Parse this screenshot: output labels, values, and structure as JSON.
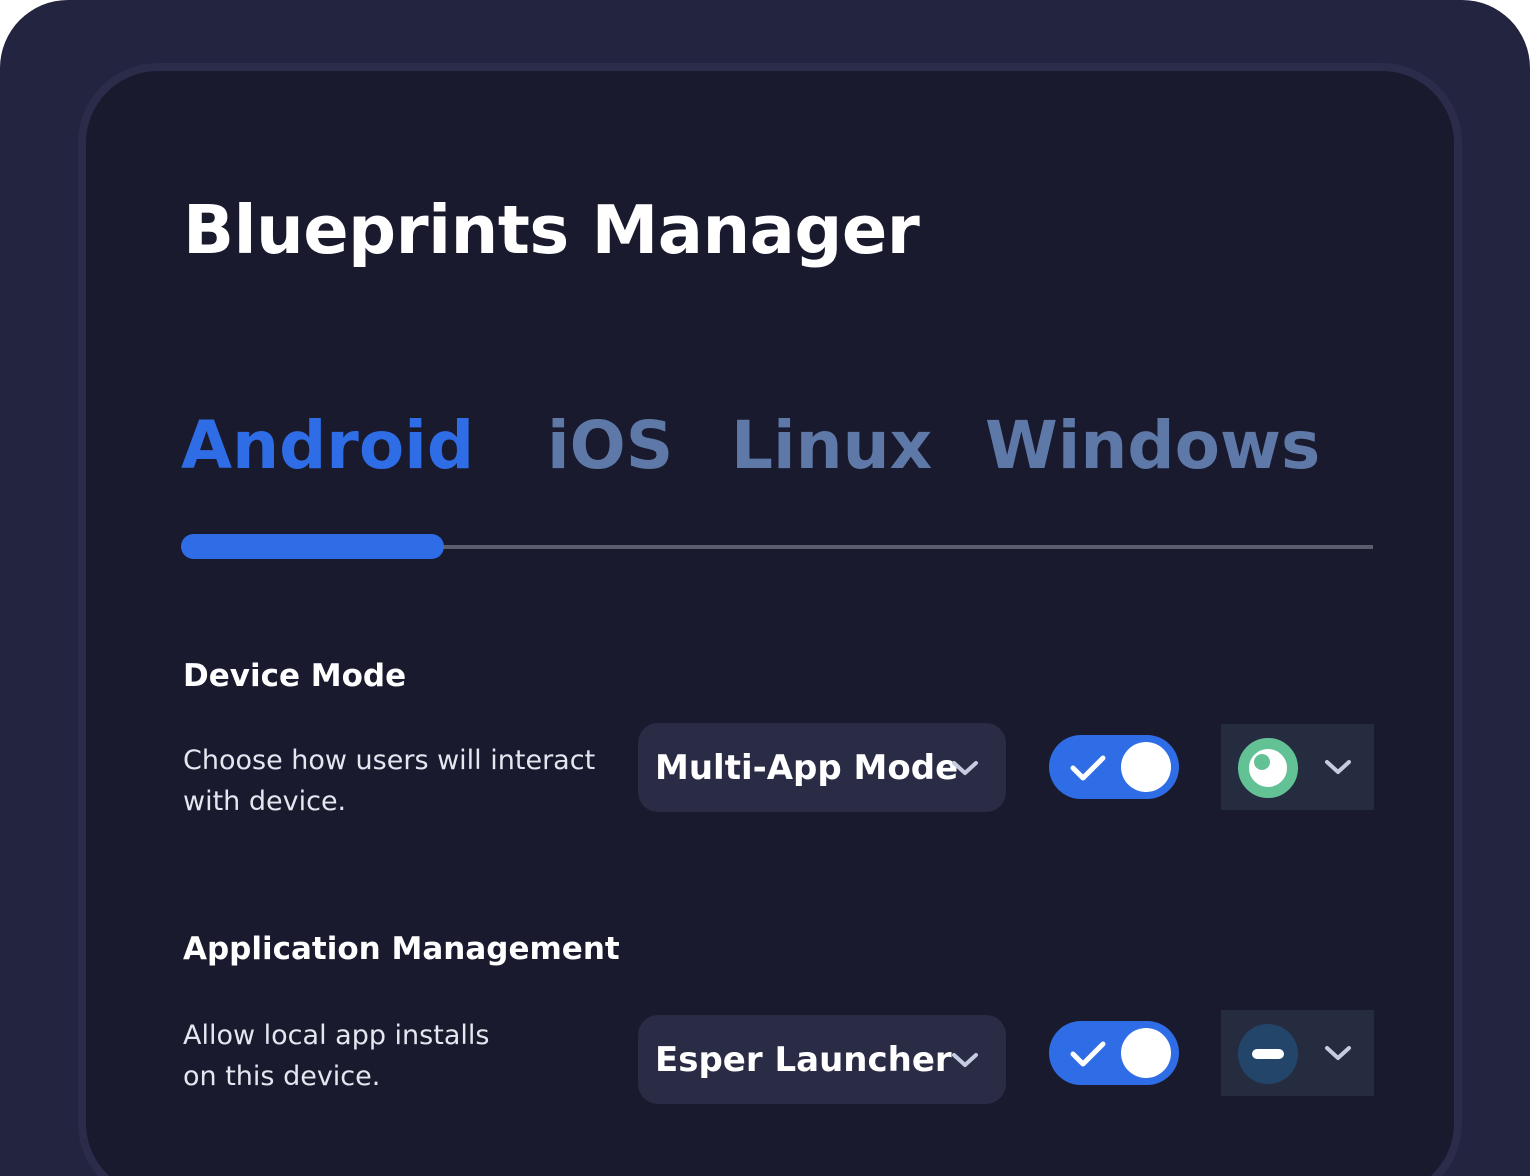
{
  "header": {
    "title": "Blueprints Manager"
  },
  "tabs": [
    {
      "label": "Android",
      "active": true
    },
    {
      "label": "iOS",
      "active": false
    },
    {
      "label": "Linux",
      "active": false
    },
    {
      "label": "Windows",
      "active": false
    }
  ],
  "sections": [
    {
      "title": "Device Mode",
      "description": "Choose how users will interact\nwith device.",
      "select_value": "Multi-App Mode",
      "toggle_on": true,
      "status_icon": "radio-on-icon",
      "status_color": "#63c196"
    },
    {
      "title": "Application Management",
      "description": "Allow local app installs\non this device.",
      "select_value": "Esper Launcher",
      "toggle_on": true,
      "status_icon": "minus-circle-icon",
      "status_color": "#24456a"
    }
  ],
  "colors": {
    "accent": "#2f6de6",
    "tab_inactive": "#5e78a8",
    "background": "#191a2e",
    "frame": "#23243f"
  }
}
